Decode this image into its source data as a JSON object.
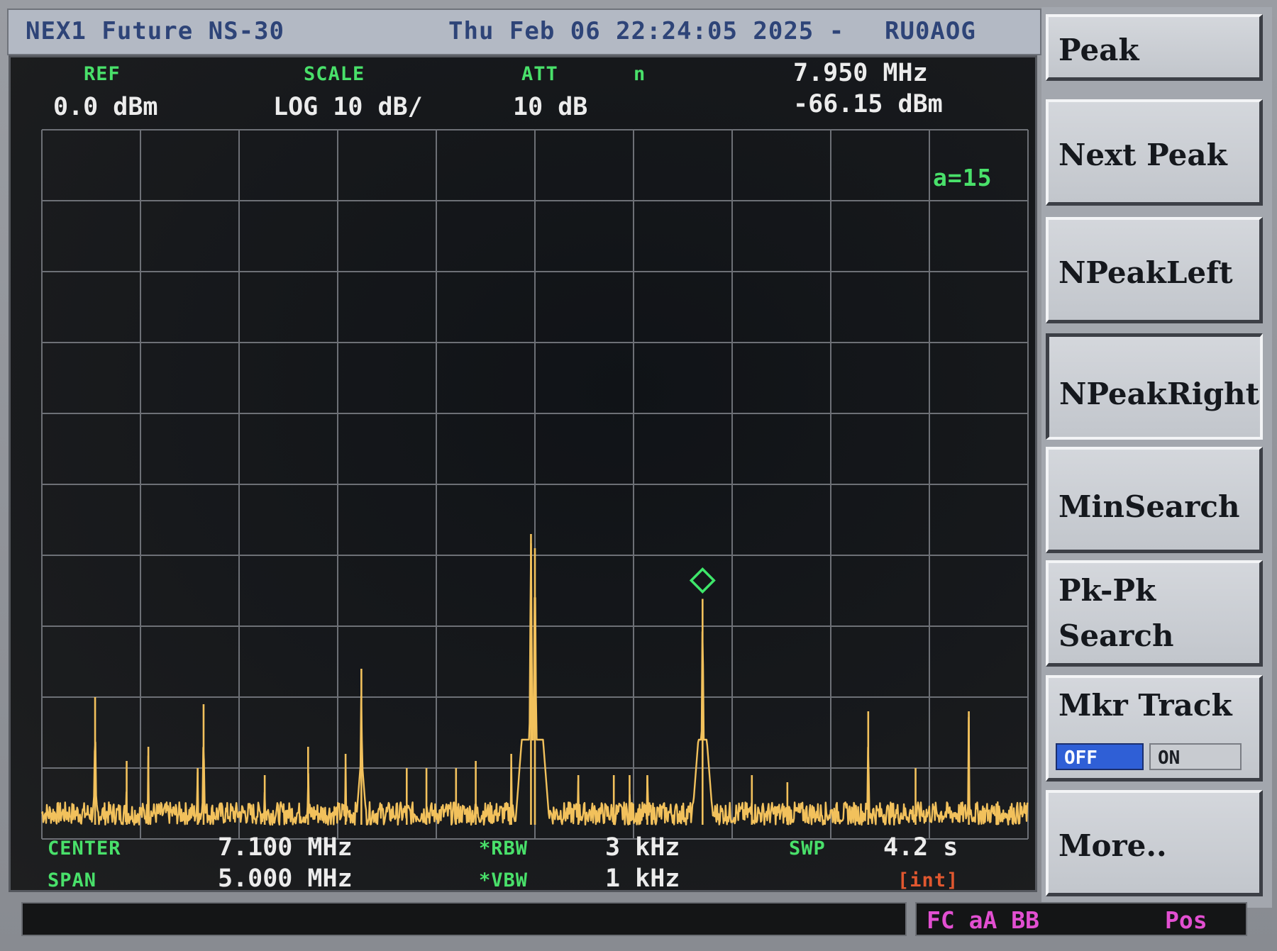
{
  "title_bar": {
    "device": "NEX1 Future NS-30",
    "datetime": "Thu Feb 06 22:24:05 2025 -",
    "callsign": "RU0AOG"
  },
  "header": {
    "ref_label": "REF",
    "ref_value": "0.0 dBm",
    "scale_label": "SCALE",
    "scale_value": "LOG 10 dB/",
    "att_label": "ATT",
    "att_value": "10 dB",
    "detector": "n",
    "marker_freq": "7.950 MHz",
    "marker_level": "-66.15 dBm",
    "avg": "a=15"
  },
  "footer": {
    "center_label": "CENTER",
    "center_value": "7.100 MHz",
    "span_label": "SPAN",
    "span_value": "5.000 MHz",
    "rbw_label": "*RBW",
    "rbw_value": "3 kHz",
    "vbw_label": "*VBW",
    "vbw_value": "1 kHz",
    "swp_label": "SWP",
    "swp_value": "4.2 s",
    "trigger": "[int]"
  },
  "softkeys": [
    {
      "label": "Peak"
    },
    {
      "label": "Next Peak"
    },
    {
      "label": "NPeakLeft"
    },
    {
      "label": "NPeakRight"
    },
    {
      "label": "MinSearch"
    },
    {
      "label": "Pk-Pk",
      "label2": "Search"
    },
    {
      "label": "Mkr Track",
      "off": "OFF",
      "on": "ON"
    },
    {
      "label": "More.."
    }
  ],
  "status": {
    "flags": "FC aA BB",
    "mode": "Pos"
  },
  "colors": {
    "trace": "#f2c15c",
    "grid": "#6d7076",
    "marker": "#3ee66a",
    "label_green": "#49e06a",
    "title_blue": "#2e4478"
  },
  "chart_data": {
    "type": "line",
    "xlim": [
      4.6,
      9.6
    ],
    "ylim": [
      -100,
      0
    ],
    "grid": true,
    "noise_floor": -98,
    "peaks": [
      {
        "x": 4.87,
        "y": -80
      },
      {
        "x": 5.03,
        "y": -89
      },
      {
        "x": 5.14,
        "y": -87
      },
      {
        "x": 5.39,
        "y": -90
      },
      {
        "x": 5.42,
        "y": -81
      },
      {
        "x": 5.73,
        "y": -91
      },
      {
        "x": 5.95,
        "y": -87
      },
      {
        "x": 6.14,
        "y": -88
      },
      {
        "x": 6.22,
        "y": -76
      },
      {
        "x": 6.45,
        "y": -90
      },
      {
        "x": 6.55,
        "y": -90
      },
      {
        "x": 6.7,
        "y": -90
      },
      {
        "x": 6.8,
        "y": -89
      },
      {
        "x": 6.98,
        "y": -88
      },
      {
        "x": 7.08,
        "y": -57
      },
      {
        "x": 7.1,
        "y": -59
      },
      {
        "x": 7.32,
        "y": -91
      },
      {
        "x": 7.5,
        "y": -91
      },
      {
        "x": 7.58,
        "y": -91
      },
      {
        "x": 7.67,
        "y": -91
      },
      {
        "x": 7.95,
        "y": -66.15
      },
      {
        "x": 8.2,
        "y": -91
      },
      {
        "x": 8.38,
        "y": -92
      },
      {
        "x": 8.79,
        "y": -82
      },
      {
        "x": 9.03,
        "y": -90
      },
      {
        "x": 9.3,
        "y": -82
      },
      {
        "x": 9.44,
        "y": -95
      }
    ],
    "marker": {
      "x": 7.95,
      "y": -66.15
    }
  }
}
